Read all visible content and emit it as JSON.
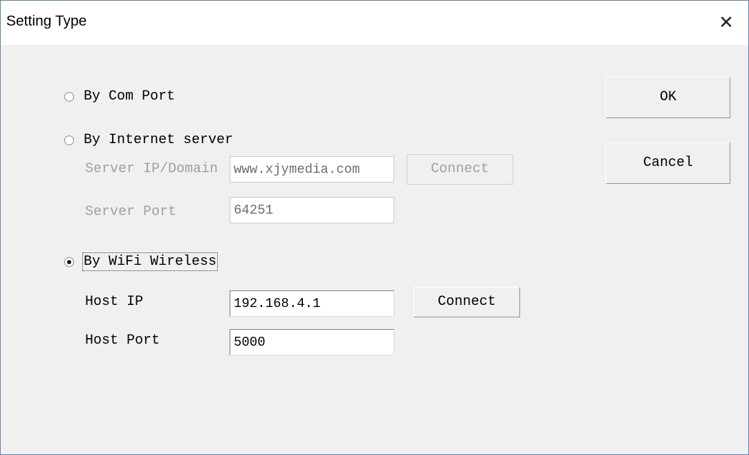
{
  "window": {
    "title": "Setting Type",
    "close_glyph": "✕"
  },
  "options": {
    "com_port": {
      "label": "By Com Port",
      "selected": false
    },
    "internet": {
      "label": "By Internet server",
      "selected": false,
      "server_ip_label": "Server IP/Domain",
      "server_ip_value": "www.xjymedia.com",
      "server_port_label": "Server Port",
      "server_port_value": "64251",
      "connect_label": "Connect"
    },
    "wifi": {
      "label": "By WiFi Wireless",
      "selected": true,
      "host_ip_label": "Host IP",
      "host_ip_value": "192.168.4.1",
      "host_port_label": "Host Port",
      "host_port_value": "5000",
      "connect_label": "Connect"
    }
  },
  "buttons": {
    "ok": "OK",
    "cancel": "Cancel"
  }
}
